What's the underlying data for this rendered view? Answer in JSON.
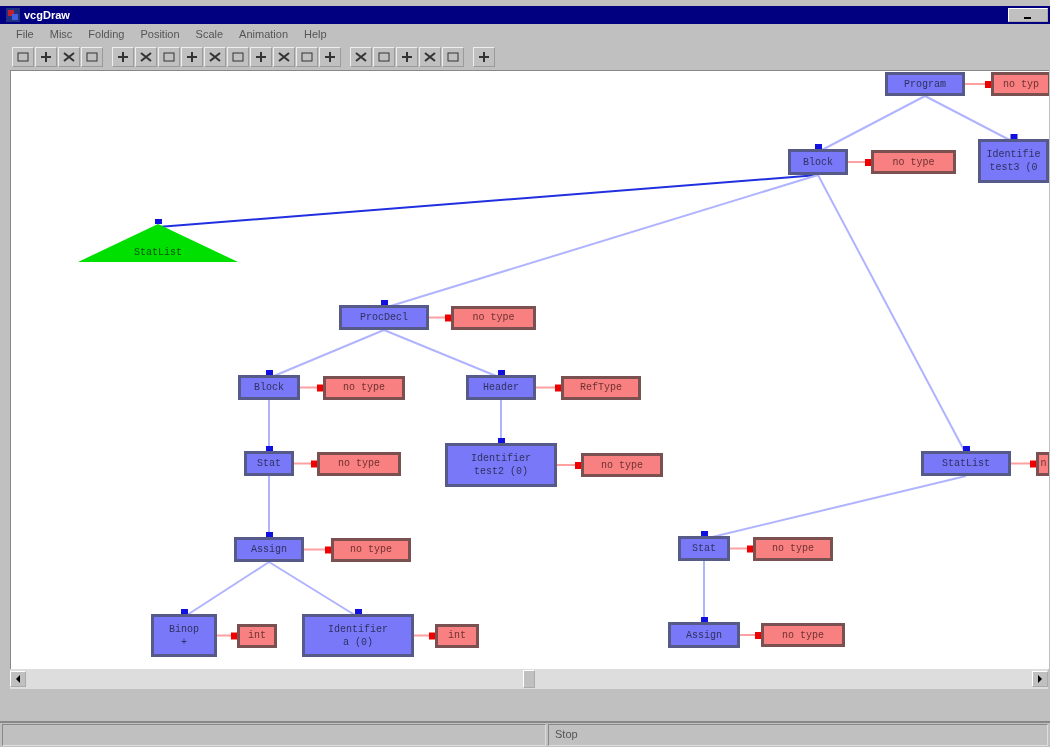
{
  "window": {
    "title": "vcgDraw"
  },
  "menu": [
    "File",
    "Misc",
    "Folding",
    "Position",
    "Scale",
    "Animation",
    "Help"
  ],
  "graph": {
    "root": {
      "label": "Program",
      "kind": "box",
      "type_label": "no typ",
      "children": [
        {
          "label": "Block",
          "kind": "box",
          "type_label": "no type",
          "children": [
            {
              "label": "StatList",
              "kind": "folded"
            },
            {
              "label": "ProcDecl",
              "kind": "box",
              "type_label": "no type",
              "children": [
                {
                  "label": "Block",
                  "kind": "box",
                  "type_label": "no type",
                  "children": [
                    {
                      "label": "Stat",
                      "kind": "box",
                      "type_label": "no type",
                      "children": [
                        {
                          "label": "Assign",
                          "kind": "box",
                          "type_label": "no type",
                          "children": [
                            {
                              "label": "Binop\n+",
                              "kind": "box",
                              "type_label": "int"
                            },
                            {
                              "label": "Identifier\na (0)",
                              "kind": "box",
                              "type_label": "int"
                            }
                          ]
                        }
                      ]
                    }
                  ]
                },
                {
                  "label": "Header",
                  "kind": "box",
                  "type_label": "RefType",
                  "children": [
                    {
                      "label": "Identifier\ntest2 (0)",
                      "kind": "box",
                      "type_label": "no type"
                    }
                  ]
                }
              ]
            },
            {
              "label": "StatList",
              "kind": "box",
              "type_label": "n",
              "children": [
                {
                  "label": "Stat",
                  "kind": "box",
                  "type_label": "no type",
                  "children": [
                    {
                      "label": "Assign",
                      "kind": "box",
                      "type_label": "no type"
                    }
                  ]
                }
              ]
            }
          ]
        },
        {
          "label": "Identifie\ntest3 (0",
          "kind": "box"
        }
      ]
    }
  },
  "status_bar": {
    "text": "Stop"
  }
}
